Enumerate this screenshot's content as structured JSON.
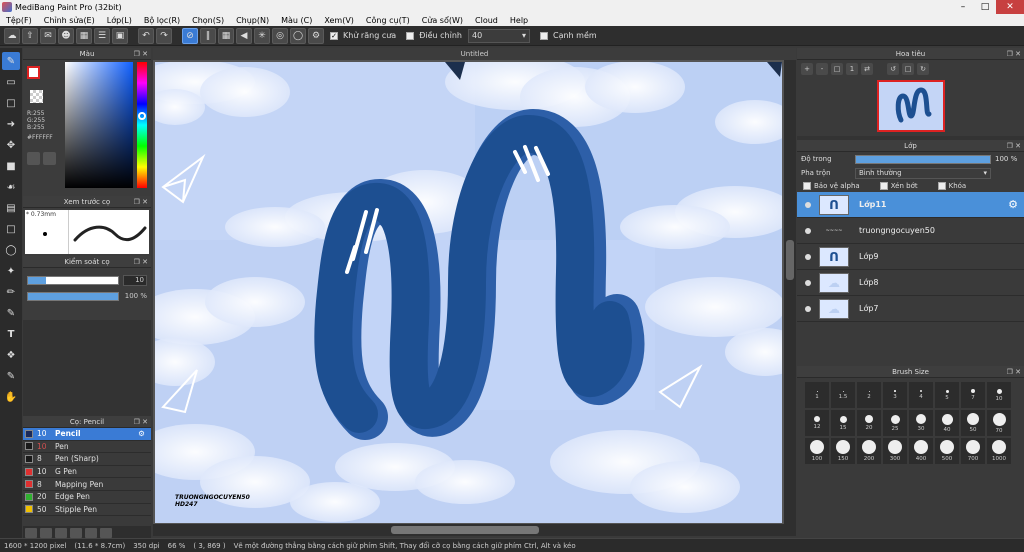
{
  "app": {
    "title": "MediBang Paint Pro (32bit)"
  },
  "menu": [
    "Tệp(F)",
    "Chỉnh sửa(E)",
    "Lớp(L)",
    "Bộ lọc(R)",
    "Chọn(S)",
    "Chụp(N)",
    "Màu (C)",
    "Xem(V)",
    "Công cụ(T)",
    "Cửa sổ(W)",
    "Cloud",
    "Help"
  ],
  "toolbar": {
    "antialias_label": "Khử răng cưa",
    "correction_label": "Điều chỉnh",
    "correction_value": "40",
    "edge_label": "Cạnh mềm"
  },
  "panels": {
    "color": {
      "title": "Màu",
      "r": "R:255",
      "g": "G:255",
      "b": "B:255",
      "hex": "#FFFFFF"
    },
    "preview": {
      "title": "Xem trước cọ",
      "size": "0.73mm"
    },
    "brush_control": {
      "title": "Kiểm soát cọ",
      "size": "10",
      "opacity": "100 %"
    },
    "brush": {
      "title": "Cọ: Pencil"
    },
    "navigator": {
      "title": "Hoa tiêu"
    },
    "layer": {
      "title": "Lớp",
      "opacity_label": "Độ trong",
      "opacity_value": "100 %",
      "blend_label": "Pha trộn",
      "blend_value": "Bình thường",
      "protect_alpha": "Bảo vệ alpha",
      "clipping": "Xén bớt",
      "lock": "Khóa"
    },
    "brush_size": {
      "title": "Brush Size"
    }
  },
  "brushes": [
    {
      "size": "10",
      "name": "Pencil",
      "color": "#1a2a5a"
    },
    {
      "size": "10",
      "name": "Pen",
      "color": "#1a1a1a"
    },
    {
      "size": "8",
      "name": "Pen (Sharp)",
      "color": "#1a1a1a"
    },
    {
      "size": "10",
      "name": "G Pen",
      "color": "#e03030"
    },
    {
      "size": "8",
      "name": "Mapping Pen",
      "color": "#e03030"
    },
    {
      "size": "20",
      "name": "Edge Pen",
      "color": "#30b030"
    },
    {
      "size": "50",
      "name": "Stipple Pen",
      "color": "#f0c000"
    }
  ],
  "layers": [
    {
      "name": "Lớp11"
    },
    {
      "name": "truongngocuyen50"
    },
    {
      "name": "Lớp9"
    },
    {
      "name": "Lớp8"
    },
    {
      "name": "Lớp7"
    }
  ],
  "brush_sizes": [
    "1",
    "1.5",
    "2",
    "3",
    "4",
    "5",
    "7",
    "10",
    "12",
    "15",
    "20",
    "25",
    "30",
    "40",
    "50",
    "70",
    "100",
    "150",
    "200",
    "300",
    "400",
    "500",
    "700",
    "1000"
  ],
  "canvas": {
    "tab_title": "Untitled",
    "signature_line1": "TRUONGNGOCUYEN50",
    "signature_line2": "HD247"
  },
  "status": {
    "size": "1600 * 1200 pixel",
    "physical": "(11.6 * 8.7cm)",
    "dpi": "350 dpi",
    "zoom": "66 %",
    "coords": "( 3, 869 )",
    "hint": "Vẽ một đường thẳng bằng cách giữ phím Shift, Thay đổi cỡ cọ bằng cách giữ phím Ctrl, Alt và kéo"
  }
}
